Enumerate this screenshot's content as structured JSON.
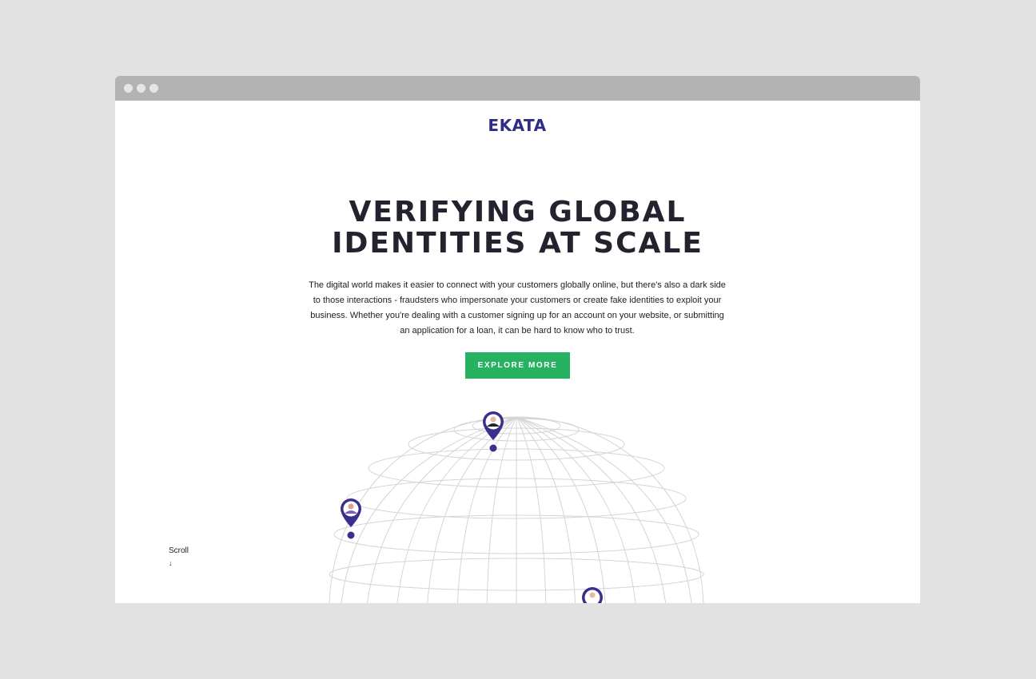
{
  "browser": {
    "window_dots": [
      "close",
      "minimize",
      "maximize"
    ]
  },
  "brand": {
    "logo_text": "EKATA",
    "logo_color": "#2e2c86"
  },
  "hero": {
    "headline_line1": "VERIFYING GLOBAL",
    "headline_line2": "IDENTITIES AT SCALE",
    "description": "The digital world makes it easier to connect with your customers globally online, but there's also a dark side to those interactions - fraudsters who impersonate your customers or create fake identities to exploit your business. Whether you're dealing with a customer signing up for an account on your website, or submitting an application for a loan, it can be hard to know who to trust.",
    "cta_label": "EXPLORE MORE",
    "cta_color": "#27b262"
  },
  "scroll_hint": {
    "label": "Scroll",
    "arrow": "↓"
  },
  "globe": {
    "line_color": "#d4d4d8",
    "pin_color": "#3a2f8c",
    "pins": [
      "person-pin-top",
      "person-pin-left",
      "person-pin-bottom"
    ]
  }
}
